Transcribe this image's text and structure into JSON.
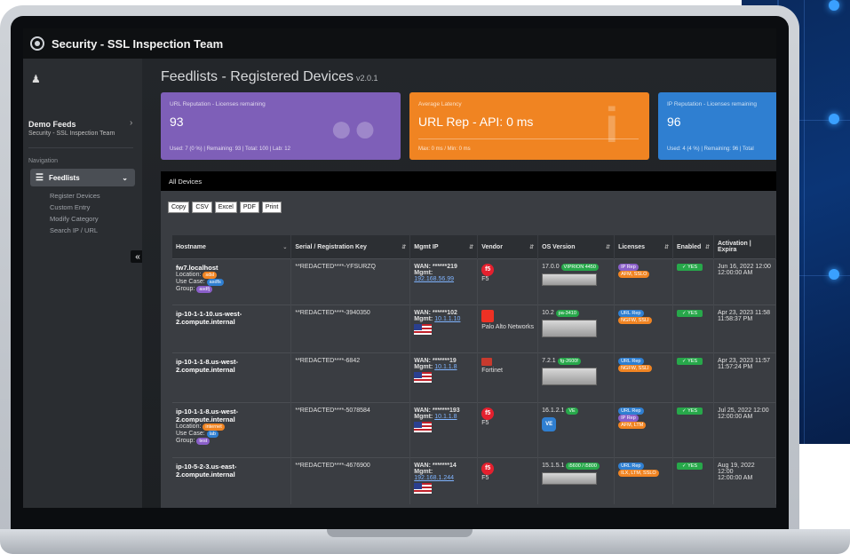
{
  "app": {
    "title": "Security - SSL Inspection Team"
  },
  "sidebar": {
    "feeds_name": "Demo Feeds",
    "feeds_sub": "Security - SSL Inspection Team",
    "nav_heading": "Navigation",
    "feedlists_label": "Feedlists",
    "items": [
      "Register Devices",
      "Custom Entry",
      "Modify Category",
      "Search IP / URL"
    ],
    "collapse_label": "«"
  },
  "page": {
    "title": "Feedlists - Registered Devices",
    "version": "v2.0.1"
  },
  "cards": {
    "url_rep": {
      "label": "URL Reputation - Licenses remaining",
      "value": "93",
      "footer": "Used: 7 (0 %) | Remaining: 93 | Total: 100 | Lab: 12"
    },
    "latency": {
      "label": "Average Latency",
      "value": "URL Rep - API: 0 ms",
      "footer": "Max: 0 ms / Min: 0 ms"
    },
    "ip_rep": {
      "label": "IP Reputation - Licenses remaining",
      "value": "96",
      "footer": "Used: 4 (4 %) | Remaining: 96 | Total"
    }
  },
  "section": {
    "title": "All Devices"
  },
  "export_buttons": [
    "Copy",
    "CSV",
    "Excel",
    "PDF",
    "Print"
  ],
  "table": {
    "headers": [
      "Hostname",
      "Serial / Registration Key",
      "Mgmt IP",
      "Vendor",
      "OS Version",
      "Licenses",
      "Enabled",
      "Activation | Expira"
    ],
    "rows": [
      {
        "host": "fw7.localhost",
        "location_label": "Location:",
        "location": "sdsl",
        "usecase_label": "Use Case:",
        "usecase": "asdfs",
        "group_label": "Group:",
        "group": "asdfj",
        "serial": "**REDACTED****-YFSURZQ",
        "wan": "WAN: ******219",
        "mgmt_label": "Mgmt:",
        "mgmt": "192.168.56.99",
        "vendor": "F5",
        "os": "17.0.0",
        "os_badge": "VIPRION 4450",
        "licenses": [
          "IP Rep",
          "AFM, SSLO"
        ],
        "enabled": "YES",
        "activation": "Jun 16, 2022 12:00",
        "expiry": "12:00:00 AM"
      },
      {
        "host": "ip-10-1-1-10.us-west-2.compute.internal",
        "serial": "**REDACTED****-3940350",
        "wan": "WAN: ******102",
        "mgmt_label": "Mgmt:",
        "mgmt": "10.1.1.10",
        "vendor": "Palo Alto Networks",
        "os": "10.2",
        "os_badge": "pa-3410",
        "licenses": [
          "URL Rep",
          "NGFW, SSLI"
        ],
        "enabled": "YES",
        "activation": "Apr 23, 2023 11:58",
        "expiry": "11:58:37 PM"
      },
      {
        "host": "ip-10-1-1-8.us-west-2.compute.internal",
        "serial": "**REDACTED****-6842",
        "wan": "WAN: *******19",
        "mgmt_label": "Mgmt:",
        "mgmt": "10.1.1.8",
        "vendor": "Fortinet",
        "os": "7.2.1",
        "os_badge": "fg-2600f",
        "licenses": [
          "URL Rep",
          "NGFW, SSLI"
        ],
        "enabled": "YES",
        "activation": "Apr 23, 2023 11:57",
        "expiry": "11:57:24 PM"
      },
      {
        "host": "ip-10-1-1-8.us-west-2.compute.internal",
        "location_label": "Location:",
        "location": "internet",
        "usecase_label": "Use Case:",
        "usecase": "lab",
        "group_label": "Group:",
        "group": "test",
        "serial": "**REDACTED****-5078584",
        "wan": "WAN: *******193",
        "mgmt_label": "Mgmt:",
        "mgmt": "10.1.1.8",
        "vendor": "F5",
        "os": "16.1.2.1",
        "os_badge": "VE",
        "licenses": [
          "URL Rep",
          "IP Rep",
          "AFM, LTM"
        ],
        "enabled": "YES",
        "activation": "Jul 25, 2022 12:00",
        "expiry": "12:00:00 AM"
      },
      {
        "host": "ip-10-5-2-3.us-east-2.compute.internal",
        "serial": "**REDACTED****-4676900",
        "wan": "WAN: *******14",
        "mgmt_label": "Mgmt:",
        "mgmt": "192.168.1.244",
        "vendor": "F5",
        "os": "15.1.5.1",
        "os_badge": "i5600 / i5800",
        "licenses": [
          "URL Rep",
          "ILX, LTM, SSLO"
        ],
        "enabled": "YES",
        "activation": "Aug 19, 2022 12:00",
        "expiry": "12:00:00 AM"
      }
    ]
  }
}
